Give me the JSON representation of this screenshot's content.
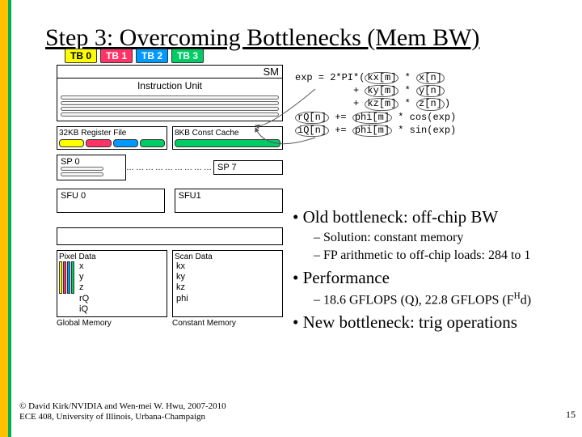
{
  "title": "Step 3: Overcoming Bottlenecks (Mem BW)",
  "tb": [
    "TB 0",
    "TB 1",
    "TB 2",
    "TB 3"
  ],
  "sm": {
    "label": "SM",
    "iu": "Instruction Unit",
    "regfile": "32KB Register File",
    "constcache": "8KB Const Cache",
    "sp0": "SP 0",
    "sp7": "SP 7",
    "sfu0": "SFU 0",
    "sfu1": "SFU1"
  },
  "mem": {
    "pixel_label": "Pixel Data",
    "scan_label": "Scan Data",
    "global": "Global Memory",
    "constant": "Constant Memory",
    "pixel_vars": [
      "x",
      "y",
      "z",
      "rQ",
      "iQ"
    ],
    "scan_vars": [
      "kx",
      "ky",
      "kz",
      "phi"
    ]
  },
  "code": {
    "l1a": "exp = 2*PI*(",
    "l1b": "kx[m]",
    "l1c": " * ",
    "l1d": "x[n]",
    "l2a": "          + ",
    "l2b": "ky[m]",
    "l2c": " * ",
    "l2d": "y[n]",
    "l3a": "          + ",
    "l3b": "kz[m]",
    "l3c": " * ",
    "l3d": "z[n]",
    "l3e": ")",
    "l4a": "rQ[n]",
    "l4b": " += ",
    "l4c": "phi[m]",
    "l4d": " * cos(exp)",
    "l5a": "iQ[n]",
    "l5b": " += ",
    "l5c": "phi[m]",
    "l5d": " * sin(exp)"
  },
  "bullets": {
    "b1": "Old bottleneck: off-chip BW",
    "b1a": "Solution: constant memory",
    "b1b": "FP arithmetic to off-chip loads: 284 to 1",
    "b2": "Performance",
    "b2a_pre": "18.6 GFLOPS (Q), 22.8 GFLOPS (F",
    "b2a_sup": "H",
    "b2a_post": "d)",
    "b3": "New bottleneck: trig operations"
  },
  "copyright": {
    "line1": "© David Kirk/NVIDIA and Wen-mei W. Hwu, 2007-2010",
    "line2": "ECE 408, University of Illinois, Urbana-Champaign"
  },
  "pagenum": "15"
}
